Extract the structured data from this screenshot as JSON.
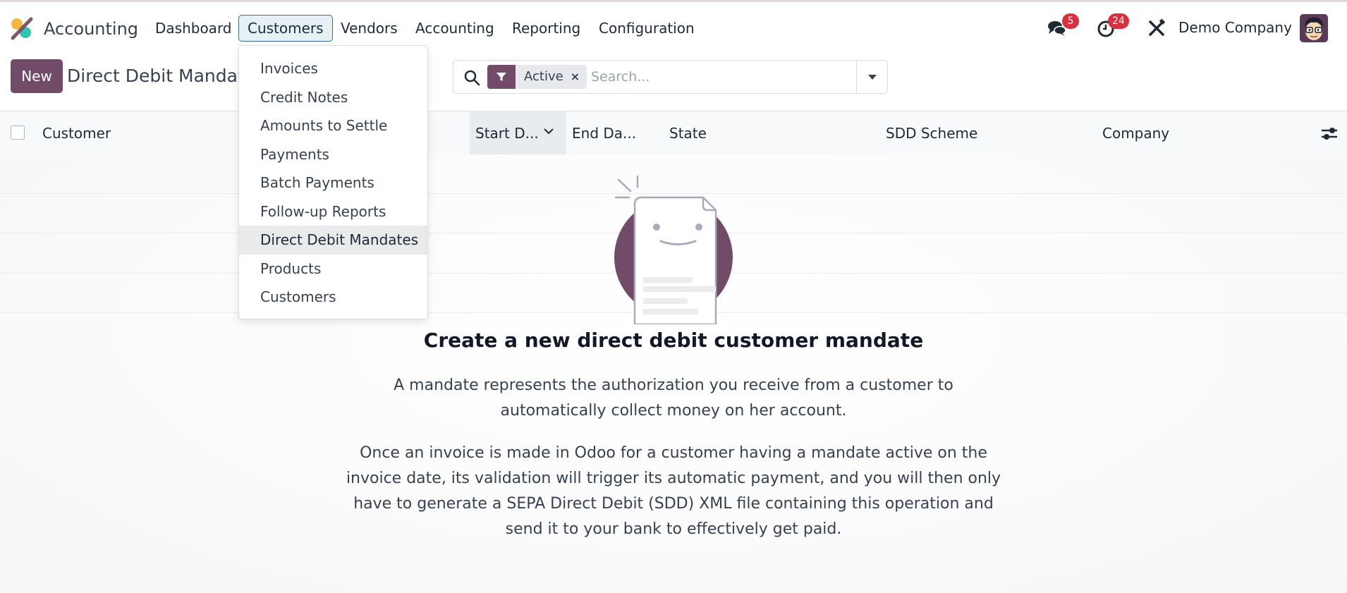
{
  "navbar": {
    "app_name": "Accounting",
    "menu": [
      {
        "label": "Dashboard",
        "active": false
      },
      {
        "label": "Customers",
        "active": true
      },
      {
        "label": "Vendors",
        "active": false
      },
      {
        "label": "Accounting",
        "active": false
      },
      {
        "label": "Reporting",
        "active": false
      },
      {
        "label": "Configuration",
        "active": false
      }
    ],
    "messages_icon": "chat-bubbles-icon",
    "messages_badge": "5",
    "activities_icon": "clock-icon",
    "activities_badge": "24",
    "debug_icon": "tools-icon",
    "company": "Demo Company",
    "avatar_icon": "user-avatar"
  },
  "control_panel": {
    "new_label": "New",
    "title": "Direct Debit Mandates",
    "search": {
      "facet_icon": "filter-icon",
      "facet_label": "Active",
      "facet_remove": "×",
      "placeholder": "Search...",
      "value": ""
    }
  },
  "list": {
    "columns": [
      "Customer",
      "Start D...",
      "End Da...",
      "State",
      "SDD Scheme",
      "Company"
    ],
    "sorted_column": "Start D...",
    "optional_columns_icon": "sliders-icon"
  },
  "dropdown": {
    "items": [
      {
        "label": "Invoices",
        "highlight": false
      },
      {
        "label": "Credit Notes",
        "highlight": false
      },
      {
        "label": "Amounts to Settle",
        "highlight": false
      },
      {
        "label": "Payments",
        "highlight": false
      },
      {
        "label": "Batch Payments",
        "highlight": false
      },
      {
        "label": "Follow-up Reports",
        "highlight": false
      },
      {
        "label": "Direct Debit Mandates",
        "highlight": true
      },
      {
        "label": "Products",
        "highlight": false
      },
      {
        "label": "Customers",
        "highlight": false
      }
    ]
  },
  "empty_state": {
    "title": "Create a new direct debit customer mandate",
    "paragraph1": "A mandate represents the authorization you receive from a customer to automatically collect money on her account.",
    "paragraph2": "Once an invoice is made in Odoo for a customer having a mandate active on the invoice date, its validation will trigger its automatic payment, and you will then only have to generate a SEPA Direct Debit (SDD) XML file containing this operation and send it to your bank to effectively get paid."
  },
  "colors": {
    "brand": "#714b67",
    "badge": "#d9303f",
    "active_menu_bg": "#e6f1f6",
    "active_menu_border": "#3b6e8c"
  }
}
